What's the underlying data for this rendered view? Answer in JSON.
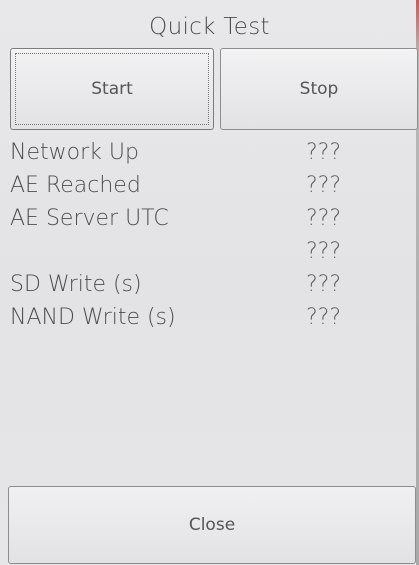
{
  "window": {
    "title": "Quick Test"
  },
  "buttons": {
    "start_label": "Start",
    "stop_label": "Stop",
    "close_label": "Close"
  },
  "results": [
    {
      "label": "Network Up",
      "value": "???"
    },
    {
      "label": "AE Reached",
      "value": "???"
    },
    {
      "label": "AE Server UTC",
      "value": "???"
    },
    {
      "label": "",
      "value": "???"
    },
    {
      "label": "SD Write (s)",
      "value": "???"
    },
    {
      "label": "NAND Write (s)",
      "value": "???"
    }
  ],
  "colors": {
    "background": "#e4e4e4",
    "text": "#4a4a4a",
    "button_border": "#8d8d8f"
  }
}
